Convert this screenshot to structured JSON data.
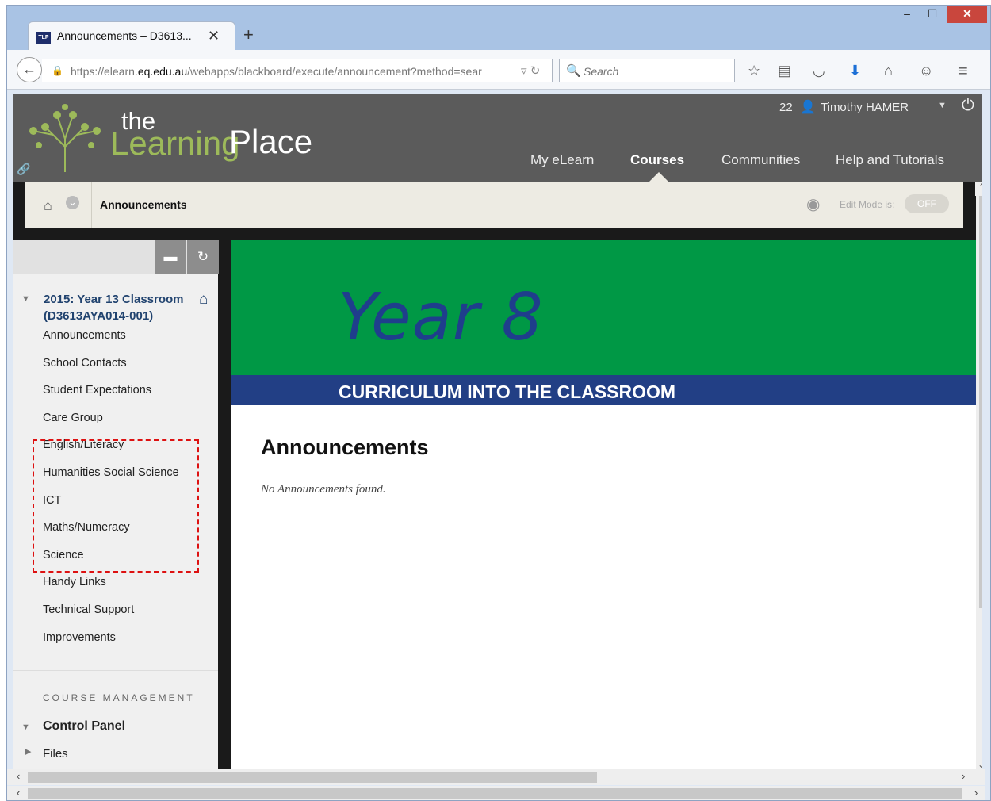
{
  "browser": {
    "tab_title": "Announcements – D3613...",
    "tab_icon_text": "TLP",
    "url_prefix": "https://elearn.",
    "url_domain": "eq.edu.au",
    "url_path": "/webapps/blackboard/execute/announcement?method=sear",
    "search_placeholder": "Search",
    "icons": [
      "back-arrow-icon",
      "lock-icon",
      "reload-icon",
      "search-icon",
      "bookmark-star-icon",
      "reading-list-icon",
      "pocket-icon",
      "download-icon",
      "home-icon",
      "chat-icon",
      "hamburger-menu-icon"
    ]
  },
  "header": {
    "logo_the": "the",
    "logo_learning": "Learning",
    "logo_place": "Place",
    "notification_count": "22",
    "user_name": "Timothy HAMER",
    "nav": [
      "My eLearn",
      "Courses",
      "Communities",
      "Help and Tutorials"
    ],
    "active_nav": "Courses"
  },
  "breadcrumb": {
    "current": "Announcements",
    "edit_mode_label": "Edit Mode is:",
    "edit_mode_state": "OFF"
  },
  "sidebar": {
    "course_name": "2015: Year 13 Classroom (D3613AYA014-001)",
    "items": [
      "Announcements",
      "School Contacts",
      "Student Expectations",
      "Care Group",
      "English/Literacy",
      "Humanities Social Science",
      "ICT",
      "Maths/Numeracy",
      "Science",
      "Handy Links",
      "Technical Support",
      "Improvements"
    ],
    "course_management_title": "COURSE MANAGEMENT",
    "control_panel": "Control Panel",
    "files": "Files"
  },
  "main": {
    "banner_year": "Year 8",
    "banner_subtitle": "CURRICULUM INTO THE CLASSROOM",
    "title": "Announcements",
    "empty_message": "No Announcements found."
  },
  "colors": {
    "banner_green": "#009845",
    "banner_blue": "#223f85",
    "course_link": "#21436f",
    "highlight_border": "#dd1111"
  }
}
